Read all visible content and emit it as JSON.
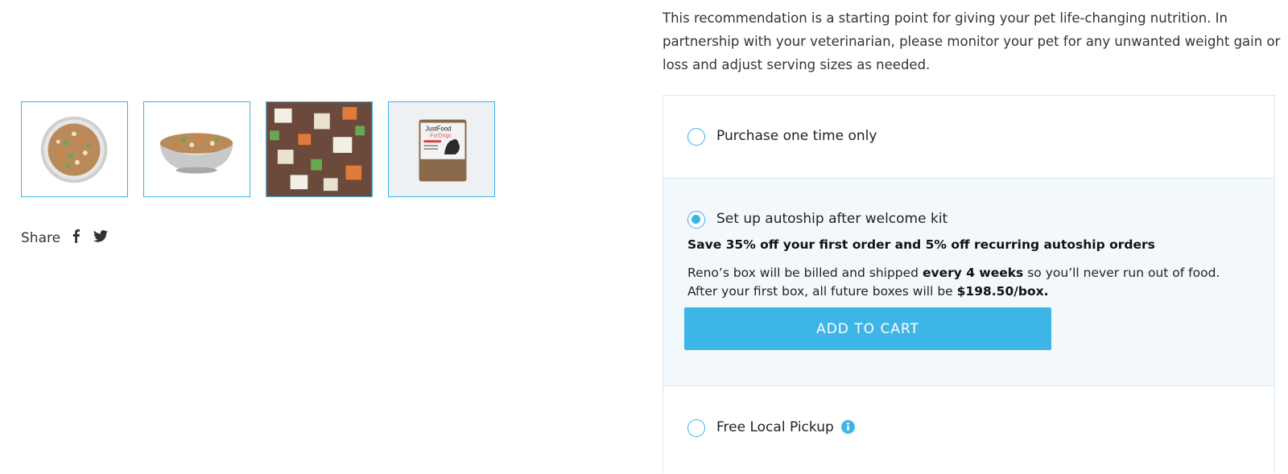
{
  "gallery": {
    "thumbnails": [
      {
        "alt": "bowl-top-view"
      },
      {
        "alt": "bowl-side-view"
      },
      {
        "alt": "food-closeup"
      },
      {
        "alt": "food-package"
      }
    ],
    "package_text": {
      "brand_line1": "JustFood",
      "brand_line2": "ForDogs"
    }
  },
  "share": {
    "label": "Share",
    "icons": [
      "facebook-icon",
      "twitter-icon"
    ]
  },
  "intro": {
    "text": "This recommendation is a starting point for giving your pet life-changing nutrition. In partnership with your veterinarian, please monitor your pet for any unwanted weight gain or loss and adjust serving sizes as needed."
  },
  "purchase_options": {
    "one_time": {
      "label": "Purchase one time only",
      "selected": false
    },
    "autoship": {
      "label": "Set up autoship after welcome kit",
      "selected": true,
      "savings": "Save 35% off your first order and 5% off recurring autoship orders",
      "billing_prefix": "Reno’s box will be billed and shipped ",
      "billing_frequency": "every 4 weeks",
      "billing_middle": " so you’ll never run out of food. After your first box, all future boxes will be ",
      "billing_price": "$198.50/box.",
      "cart_button": "ADD TO CART"
    },
    "pickup": {
      "label": "Free Local Pickup",
      "selected": false,
      "info_icon": "info-icon"
    }
  },
  "colors": {
    "accent": "#3db5e6",
    "panel_bg": "#f2f8fc",
    "border": "#d5ebf5"
  }
}
